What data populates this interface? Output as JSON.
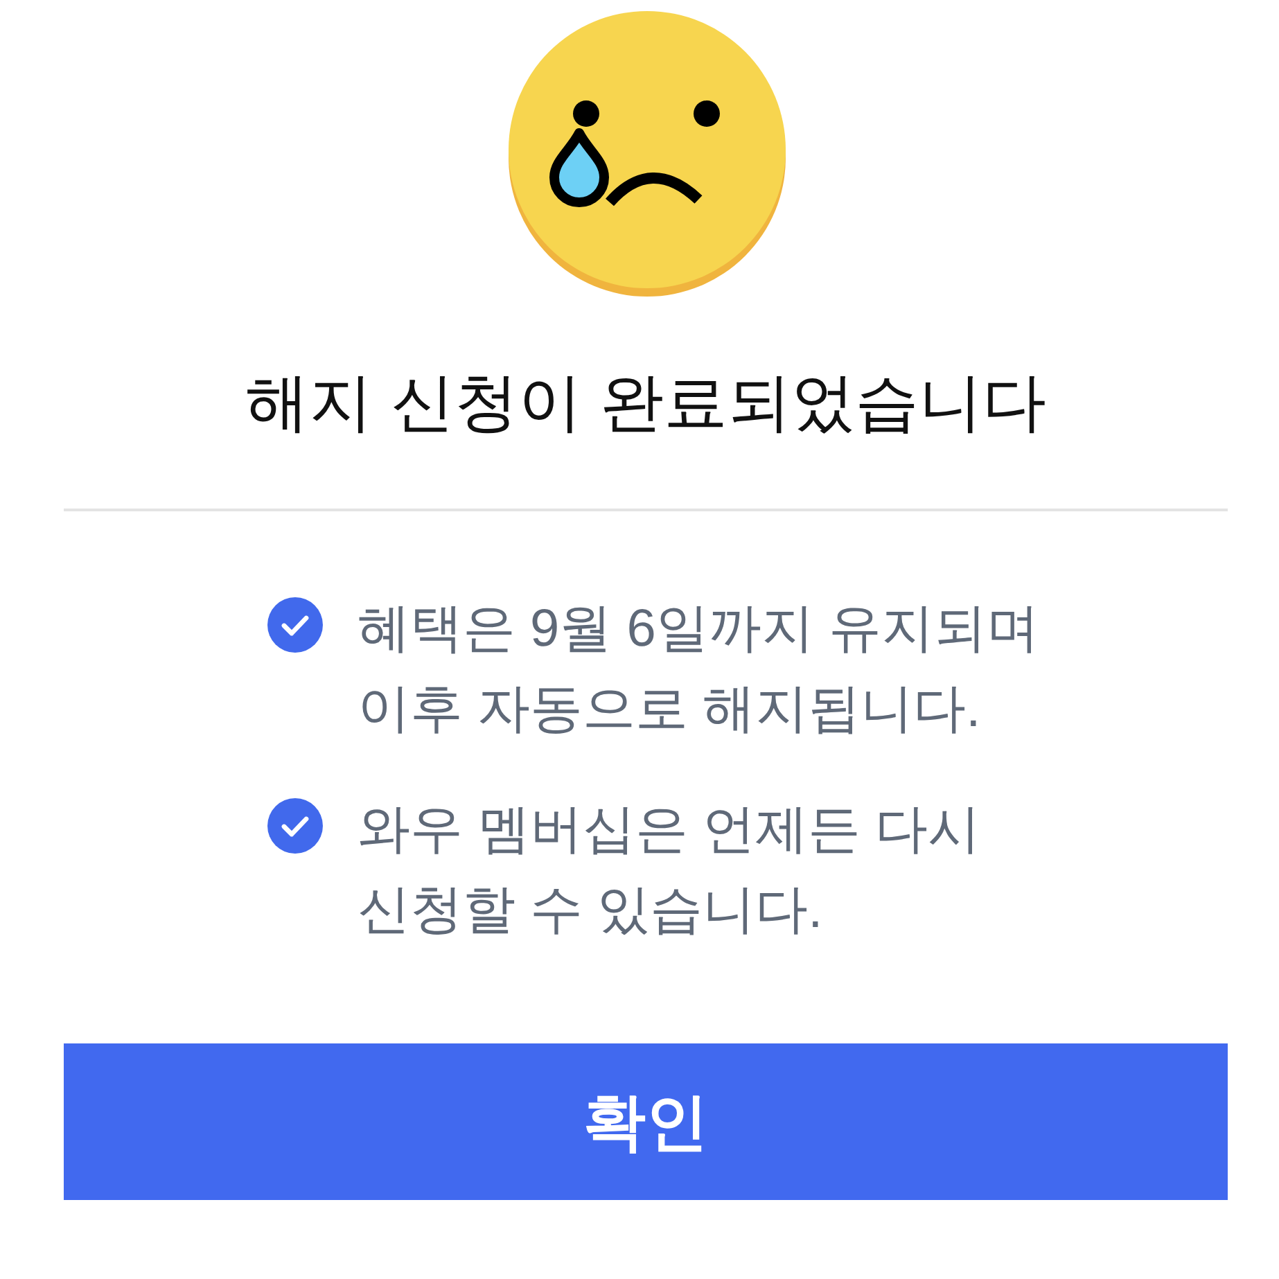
{
  "title": "해지 신청이 완료되었습니다",
  "notices": [
    {
      "text": "혜택은 9월 6일까지 유지되며\n이후 자동으로 해지됩니다.",
      "checked": true
    },
    {
      "text": "와우 멤버십은 언제든 다시\n신청할 수 있습니다.",
      "checked": true
    }
  ],
  "confirm_button": {
    "label": "확인"
  }
}
